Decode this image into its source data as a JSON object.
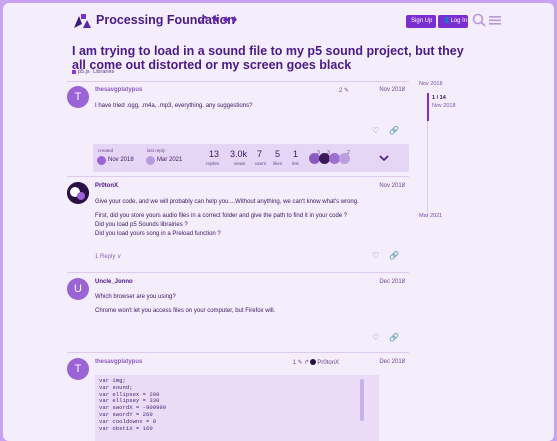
{
  "header": {
    "brand": "Processing Foundation",
    "brand_glyphs": "↗★♠♦",
    "signup_label": "Sign Up",
    "login_label": "Log In",
    "search_icon": "search-icon",
    "menu_icon": "hamburger-menu-icon"
  },
  "topic": {
    "title": "I am trying to load in a sound file to my p5 sound project, but they all come out distorted or my screen goes black",
    "category": "p5.js",
    "subcategory": "Libraries"
  },
  "posts": [
    {
      "avatar_letter": "T",
      "username": "thesavgplatypus",
      "edit_count": "2",
      "date": "Nov 2018",
      "lines": [
        "I have tried .ogg, .m4a, .mp3, everything. any suggestions?"
      ]
    },
    {
      "username": "Pr0tonX",
      "date": "Nov 2018",
      "lines": [
        "Give your code, and we will probably can help you....Without anything, we can't know what's wrong.",
        "First, did you store yours audio files in a correct folder and give the path to find it in your code ?",
        "Did you load p5 Sounds librairies ?",
        "Did you load yours song in a Preload function ?"
      ],
      "replies": "1 Reply"
    },
    {
      "avatar_letter": "U",
      "username": "Uncle_Jonno",
      "date": "Dec 2018",
      "lines": [
        "Which browser are you using?",
        "Chrome won't let you access files on your computer, but Firefox will."
      ]
    },
    {
      "avatar_letter": "T",
      "username": "thesavgplatypus",
      "edit_count": "1",
      "reply_to": "Pr0tonX",
      "date": "Dec 2018",
      "code": [
        "var img;",
        "var sound;",
        "var ellipsex = 200",
        "var ellipsey = 330",
        "var swordX = -909999",
        "var swordY = 260",
        "var cooldownx = 0",
        "var obst1X = 160"
      ]
    }
  ],
  "stats": {
    "created_label": "created",
    "created_value": "Nov 2018",
    "last_reply_label": "last reply",
    "last_reply_value": "Mar 2021",
    "replies": "13",
    "replies_label": "replies",
    "views": "3.0k",
    "views_label": "views",
    "users": "7",
    "users_label": "users",
    "likes": "5",
    "likes_label": "likes",
    "links": "1",
    "links_label": "link",
    "badge_counts": [
      "3",
      "3",
      "2"
    ]
  },
  "timeline": {
    "start": "Nov 2018",
    "position": "1 / 14",
    "position_date": "Nov 2018",
    "end": "Mar 2021"
  }
}
